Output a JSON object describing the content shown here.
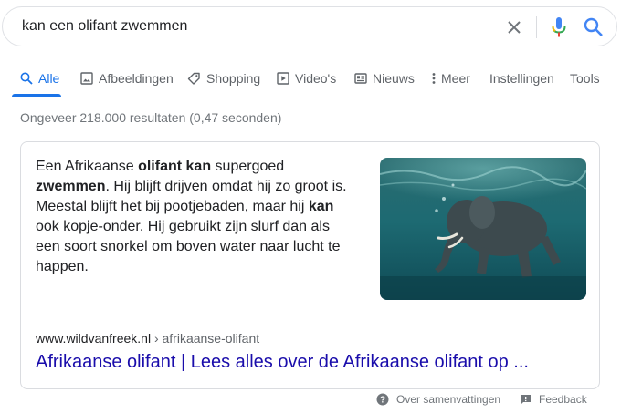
{
  "search": {
    "query": "kan een olifant zwemmen"
  },
  "tabs": [
    {
      "label": "Alle",
      "icon": "search-icon",
      "active": true
    },
    {
      "label": "Afbeeldingen",
      "icon": "image-icon"
    },
    {
      "label": "Shopping",
      "icon": "tag-icon"
    },
    {
      "label": "Video's",
      "icon": "video-icon"
    },
    {
      "label": "Nieuws",
      "icon": "news-icon"
    },
    {
      "label": "Meer",
      "icon": "more-vert-icon"
    },
    {
      "label": "Instellingen"
    },
    {
      "label": "Tools"
    }
  ],
  "result_stats": "Ongeveer 218.000 resultaten (0,47 seconden)",
  "featured_snippet": {
    "text_parts": [
      {
        "t": "Een Afrikaanse ",
        "b": false
      },
      {
        "t": "olifant kan",
        "b": true
      },
      {
        "t": " supergoed ",
        "b": false
      },
      {
        "t": "zwemmen",
        "b": true
      },
      {
        "t": ". Hij blijft drijven omdat hij zo groot is. Meestal blijft het bij pootjebaden, maar hij ",
        "b": false
      },
      {
        "t": "kan",
        "b": true
      },
      {
        "t": " ook kopje-onder. Hij gebruikt zijn slurf dan als een soort snorkel om boven water naar lucht te happen.",
        "b": false
      }
    ],
    "image_alt": "elephant-swimming-underwater",
    "cite_domain": "www.wildvanfreek.nl",
    "cite_path": " › afrikaanse-olifant",
    "link_title": "Afrikaanse olifant | Lees alles over de Afrikaanse olifant op ..."
  },
  "footer": {
    "about": "Over samenvattingen",
    "feedback": "Feedback"
  },
  "colors": {
    "accent": "#1a73e8",
    "link": "#1a0dab",
    "muted": "#70757a"
  }
}
